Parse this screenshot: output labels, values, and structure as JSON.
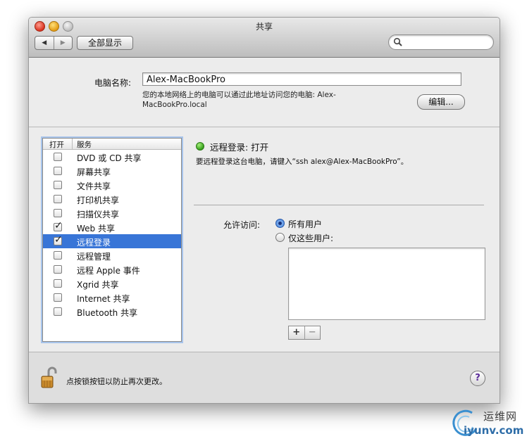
{
  "window": {
    "title": "共享"
  },
  "toolbar": {
    "back_glyph": "◀",
    "forward_glyph": "▶",
    "show_all_label": "全部显示",
    "search_placeholder": "",
    "search_icon": "magnifier-icon"
  },
  "computer": {
    "name_label": "电脑名称:",
    "name_value": "Alex-MacBookPro",
    "note": "您的本地网络上的电脑可以通过此地址访问您的电脑: Alex-MacBookPro.local",
    "edit_label": "编辑..."
  },
  "services": {
    "header_on": "打开",
    "header_service": "服务",
    "items": [
      {
        "label": "DVD 或 CD 共享",
        "checked": false,
        "selected": false
      },
      {
        "label": "屏幕共享",
        "checked": false,
        "selected": false
      },
      {
        "label": "文件共享",
        "checked": false,
        "selected": false
      },
      {
        "label": "打印机共享",
        "checked": false,
        "selected": false
      },
      {
        "label": "扫描仪共享",
        "checked": false,
        "selected": false
      },
      {
        "label": "Web 共享",
        "checked": true,
        "selected": false
      },
      {
        "label": "远程登录",
        "checked": true,
        "selected": true
      },
      {
        "label": "远程管理",
        "checked": false,
        "selected": false
      },
      {
        "label": "远程 Apple 事件",
        "checked": false,
        "selected": false
      },
      {
        "label": "Xgrid 共享",
        "checked": false,
        "selected": false
      },
      {
        "label": "Internet 共享",
        "checked": false,
        "selected": false
      },
      {
        "label": "Bluetooth 共享",
        "checked": false,
        "selected": false
      }
    ]
  },
  "detail": {
    "status": "远程登录: 打开",
    "status_color": "#3cb521",
    "hint": "要远程登录这台电脑，请键入“ssh alex@Alex-MacBookPro”。",
    "access_label": "允许访问:",
    "all_users_label": "所有用户",
    "some_users_label": "仅这些用户:",
    "selected_access": "all",
    "add_label": "+",
    "remove_label": "−"
  },
  "footer": {
    "lock_text": "点按锁按钮以防止再次更改。",
    "help_label": "?",
    "lock_icon": "unlocked-padlock-icon"
  },
  "watermark": {
    "top": "运维网",
    "bottom": "iyunv.com"
  },
  "colors": {
    "selection": "#3875d7",
    "focus_ring": "#a7c4eb"
  }
}
